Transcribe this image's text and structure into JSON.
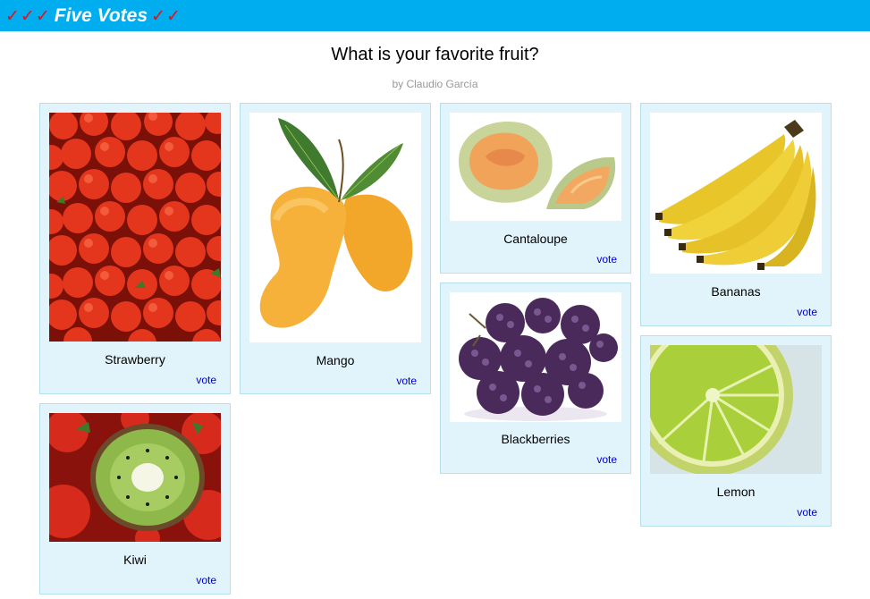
{
  "header": {
    "brand_checks_left": "✓✓✓",
    "brand_title": "Five Votes",
    "brand_checks_right": "✓✓",
    "bar_color": "#00aeef",
    "check_color": "#e0121a"
  },
  "poll": {
    "title": "What is your favorite fruit?",
    "author": "by Claudio García"
  },
  "options": [
    {
      "label": "Strawberry",
      "vote_label": "vote",
      "image": "strawberry-photo"
    },
    {
      "label": "Mango",
      "vote_label": "vote",
      "image": "mango-photo"
    },
    {
      "label": "Cantaloupe",
      "vote_label": "vote",
      "image": "cantaloupe-photo"
    },
    {
      "label": "Bananas",
      "vote_label": "vote",
      "image": "bananas-photo"
    },
    {
      "label": "Blackberries",
      "vote_label": "vote",
      "image": "blackberries-photo"
    },
    {
      "label": "Lemon",
      "vote_label": "vote",
      "image": "lemon-photo"
    },
    {
      "label": "Kiwi",
      "vote_label": "vote",
      "image": "kiwi-photo"
    }
  ],
  "colors": {
    "card_bg": "#e1f4fb",
    "card_border": "#b8dfee",
    "link": "#0000cc"
  }
}
